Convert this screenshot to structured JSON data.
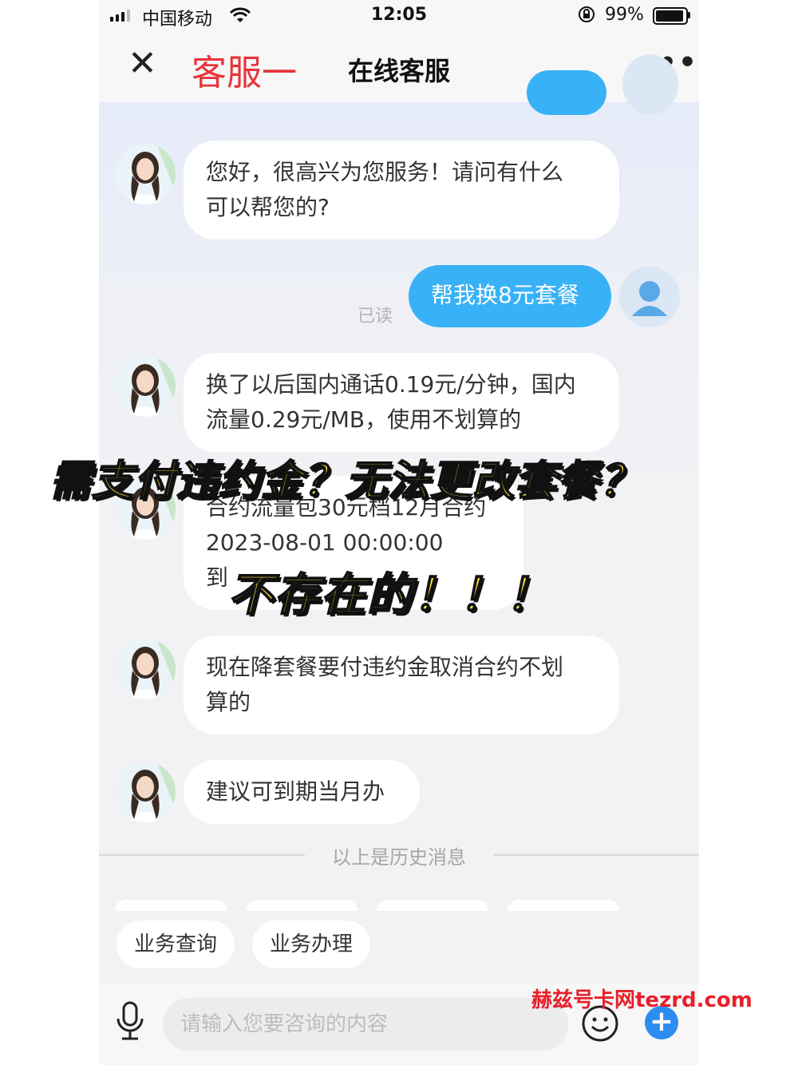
{
  "status_bar": {
    "carrier": "中国移动",
    "time": "12:05",
    "battery": "99%"
  },
  "nav": {
    "tag": "客服一",
    "title": "在线客服"
  },
  "messages": [
    {
      "from": "agent",
      "text_lines": [
        "您好，很高兴为您服务！请问有什么",
        "可以帮您的?"
      ]
    },
    {
      "from": "user",
      "text": "帮我换8元套餐",
      "status": "已读"
    },
    {
      "from": "agent",
      "text_lines": [
        "换了以后国内通话0.19元/分钟，国内",
        "流量0.29元/MB，使用不划算的"
      ]
    },
    {
      "from": "agent",
      "text_lines": [
        "合约流量包30元档12月合约",
        "2023-08-01 00:00:00",
        "到"
      ]
    },
    {
      "from": "agent",
      "text_lines": [
        "现在降套餐要付违约金取消合约不划",
        "算的"
      ]
    },
    {
      "from": "agent",
      "text_lines": [
        "建议可到期当月办"
      ]
    }
  ],
  "history_label": "以上是历史消息",
  "quick_chips": [
    "业务查询",
    "业务办理"
  ],
  "input": {
    "placeholder": "请输入您要咨询的内容"
  },
  "overlay": {
    "headline": "需支付违约金？无法更改套餐？",
    "subline": "不存在的！！！"
  },
  "watermark": "赫兹号卡网tezrd.com",
  "colors": {
    "user_bubble": "#38b1f6",
    "tag_red": "#e8333a",
    "overlay_yellow": "#ffe53b",
    "watermark_red": "#e8202a"
  }
}
